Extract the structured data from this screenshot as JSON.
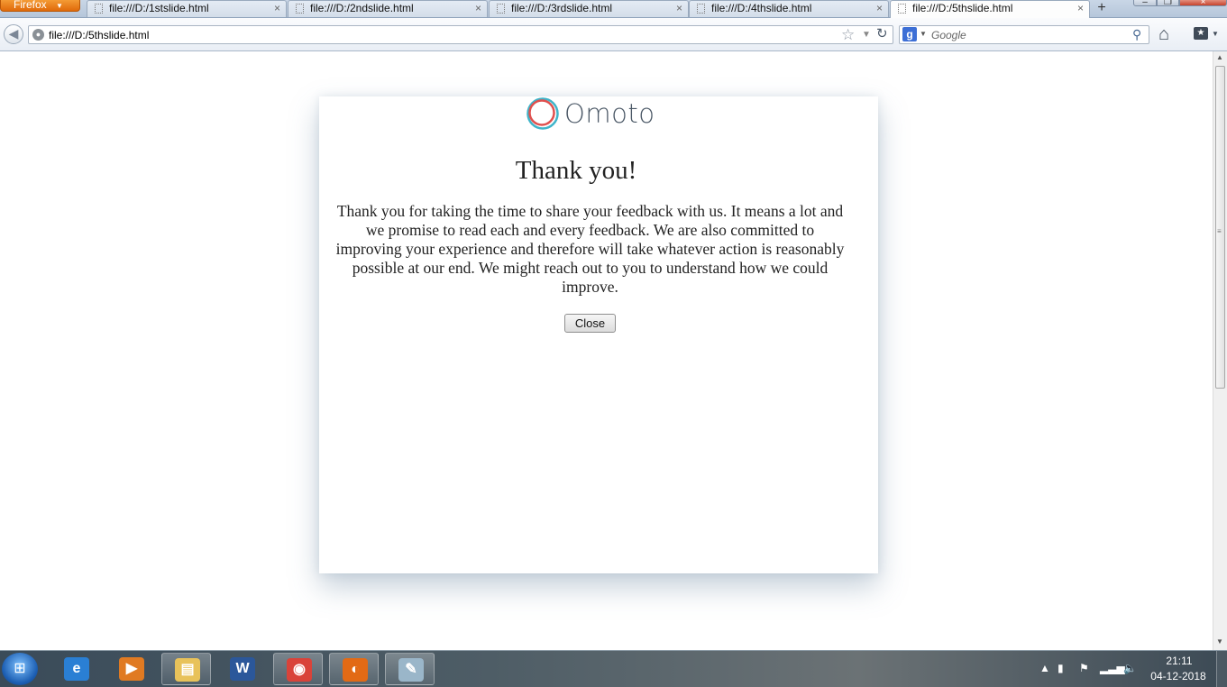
{
  "browser": {
    "app_button_label": "Firefox",
    "tabs": [
      {
        "label": "file:///D:/1stslide.html"
      },
      {
        "label": "file:///D:/2ndslide.html"
      },
      {
        "label": "file:///D:/3rdslide.html"
      },
      {
        "label": "file:///D:/4thslide.html"
      },
      {
        "label": "file:///D:/5thslide.html",
        "selected": true
      }
    ],
    "tab_close_glyph": "×",
    "new_tab_glyph": "+",
    "url": "file:///D:/5thslide.html",
    "search_placeholder": "Google"
  },
  "page": {
    "logo_text": "Omoto",
    "logo_colors": {
      "outer_ring": "#3fb4c9",
      "inner_ring": "#e0504e"
    },
    "title": "Thank you!",
    "message": "Thank you for taking the time to share your feedback with us. It means a lot and we promise to read each and every feedback. We are also committed to improving your experience and therefore will take whatever action is reasonably possible at our end. We might reach out to you to understand how we could improve.",
    "close_label": "Close"
  },
  "taskbar": {
    "apps": [
      {
        "name": "internet-explorer-icon",
        "glyph": "e",
        "color": "#2a7fd4",
        "open": false
      },
      {
        "name": "media-player-icon",
        "glyph": "▶",
        "color": "#e07a22",
        "open": false
      },
      {
        "name": "file-explorer-icon",
        "glyph": "▤",
        "color": "#e8c25a",
        "open": true
      },
      {
        "name": "word-icon",
        "glyph": "W",
        "color": "#2b579a",
        "open": false
      },
      {
        "name": "chrome-icon",
        "glyph": "◉",
        "color": "#d9433a",
        "open": true
      },
      {
        "name": "firefox-icon",
        "glyph": "◐",
        "color": "#e26a15",
        "open": true
      },
      {
        "name": "notepad-icon",
        "glyph": "✎",
        "color": "#9ab6c9",
        "open": true
      }
    ],
    "clock_time": "21:11",
    "clock_date": "04-12-2018"
  }
}
